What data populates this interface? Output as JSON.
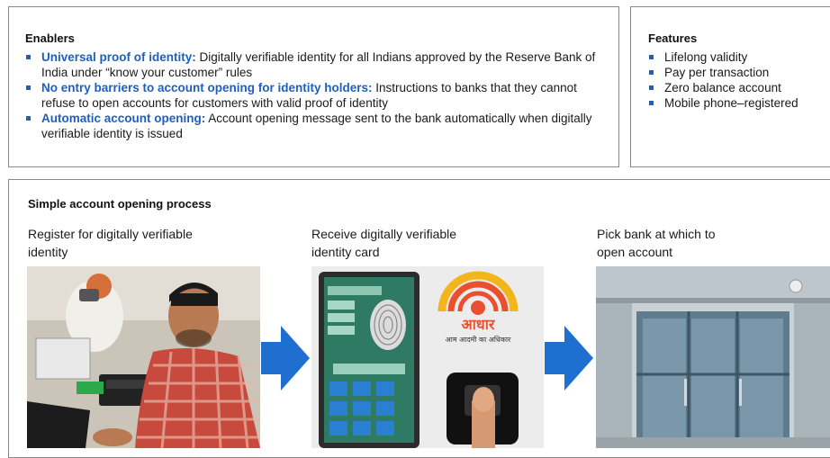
{
  "enablers": {
    "title": "Enablers",
    "items": [
      {
        "highlight": "Universal proof of identity:",
        "text": " Digitally verifiable identity for all Indians approved by the Reserve Bank of India under “know your customer” rules"
      },
      {
        "highlight": "No entry barriers to account opening for identity holders:",
        "text": " Instructions to banks that they cannot refuse to open accounts for customers with valid proof of identity"
      },
      {
        "highlight": "Automatic account opening:",
        "text": " Account opening message sent to the bank automatically when digitally verifiable identity is issued"
      }
    ]
  },
  "features": {
    "title": "Features",
    "items": [
      "Lifelong validity",
      "Pay per transaction",
      "Zero balance account",
      "Mobile phone–registered"
    ]
  },
  "process": {
    "title": "Simple account opening process",
    "steps": [
      {
        "label_line1": "Register for digitally verifiable",
        "label_line2": "identity",
        "photo_icon": "photo-registration-icon"
      },
      {
        "label_line1": "Receive digitally verifiable",
        "label_line2": "identity card",
        "photo_icon": "photo-identity-card-icon"
      },
      {
        "label_line1": "Pick bank at which to",
        "label_line2": "open account",
        "photo_icon": "photo-bank-building-icon"
      }
    ],
    "card_logo_text": "आधार",
    "card_logo_subtext": "आम आदमी का अधिकार"
  },
  "colors": {
    "accent": "#1f5fbf",
    "arrow": "#1f6fd1",
    "border": "#8a8a8a"
  }
}
